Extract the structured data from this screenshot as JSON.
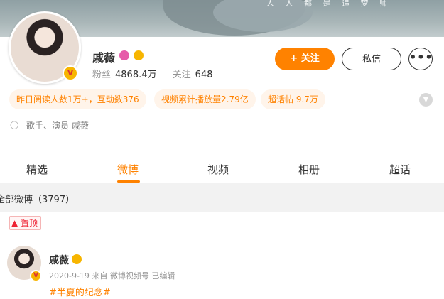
{
  "banner": {
    "text": "人 人 都 是 追 梦 师"
  },
  "profile": {
    "name": "戚薇",
    "fans_label": "粉丝",
    "fans_value": "4868.4万",
    "following_label": "关注",
    "following_value": "648",
    "follow_button": "+ 关注",
    "message_button": "私信",
    "more_button": "•••",
    "verify_badge": "V"
  },
  "tags": [
    "昨日阅读人数1万+，互动数376",
    "视频累计播放量2.79亿",
    "超话帖 9.7万"
  ],
  "verification": "歌手、演员 戚薇",
  "tabs": [
    "精选",
    "微博",
    "视频",
    "相册",
    "超话"
  ],
  "active_tab": "微博",
  "feed": {
    "all_posts": "全部微博（3797）",
    "pinned_label": "置顶",
    "post": {
      "author": "戚薇",
      "meta": "2020-9-19  来自 微博视频号 已编辑",
      "topic": "#半夏的纪念#"
    }
  },
  "colors": {
    "accent": "#ff8200",
    "pin": "#e23333",
    "verified": "#f7b500"
  },
  "icons": [
    "shield-icon",
    "expand-chevron-icon",
    "pin-icon",
    "verified-v-icon",
    "super-topic-icon",
    "crown-icon"
  ]
}
